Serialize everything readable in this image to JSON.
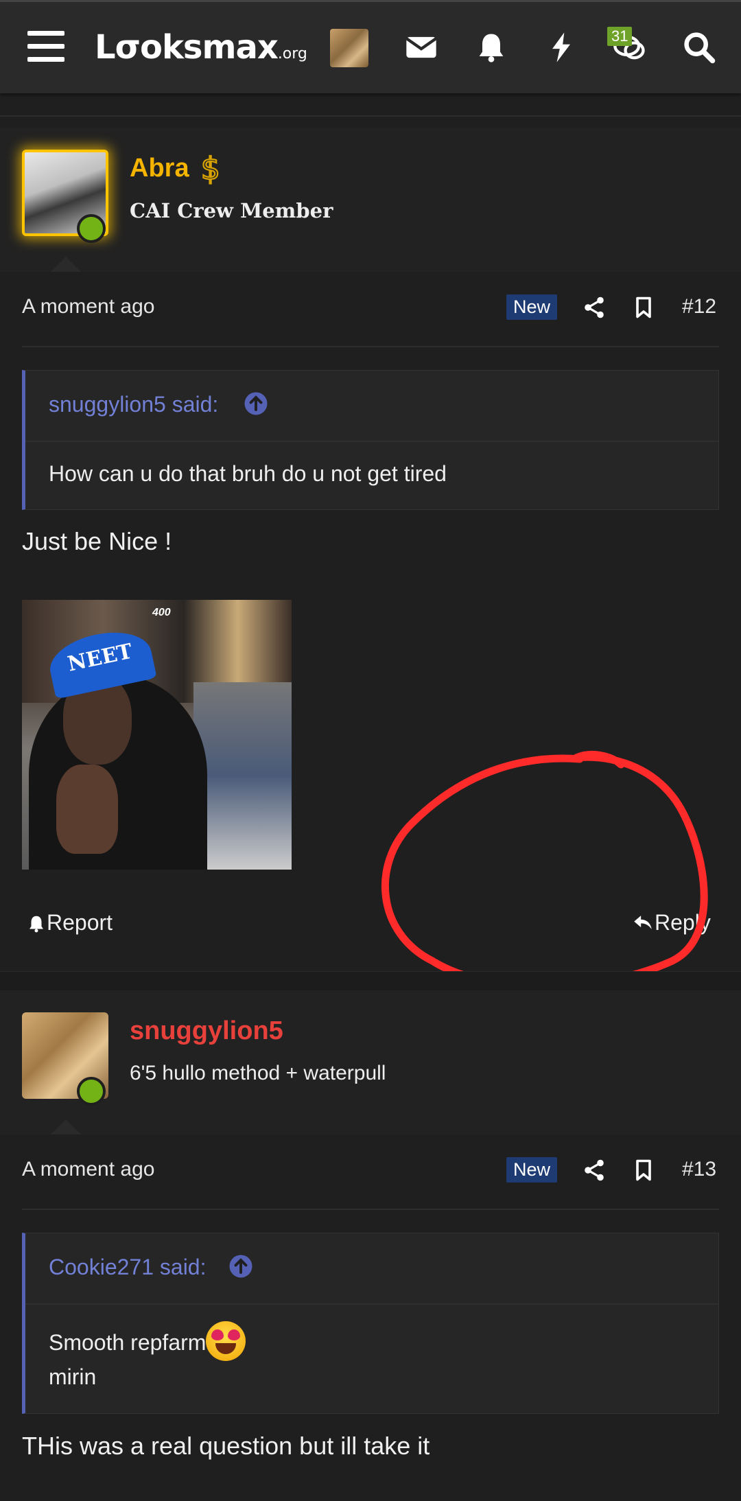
{
  "header": {
    "logo_main": "Lσoksmax",
    "logo_suffix": ".org",
    "notification_count": "31",
    "icons": [
      "menu-icon",
      "envelope-icon",
      "bell-icon",
      "bolt-icon",
      "chat-icon",
      "search-icon"
    ]
  },
  "posts": [
    {
      "author": "Abra",
      "author_color": "#f5b400",
      "title": "CAI Crew Member",
      "time": "A moment ago",
      "new_label": "New",
      "number": "#12",
      "quote": {
        "author": "snuggylion5 said:",
        "text": "How can u do that bruh do u not get tired"
      },
      "message": "Just be Nice !",
      "image_hat_text": "NEET",
      "image_sign_text": "400",
      "report_label": "Report",
      "reply_label": "Reply"
    },
    {
      "author": "snuggylion5",
      "author_color": "#e8403b",
      "title": "6'5 hullo method + waterpull",
      "time": "A moment ago",
      "new_label": "New",
      "number": "#13",
      "quote": {
        "author": "Cookie271 said:",
        "line1": "Smooth repfarm",
        "line2": "mirin"
      },
      "message": "THis was a real question but ill take it"
    }
  ],
  "colors": {
    "background": "#1f1f1f",
    "quote_accent": "#5561b5",
    "new_badge": "#1f3b73",
    "online": "#74b316",
    "annotation": "#ff2a2a"
  }
}
